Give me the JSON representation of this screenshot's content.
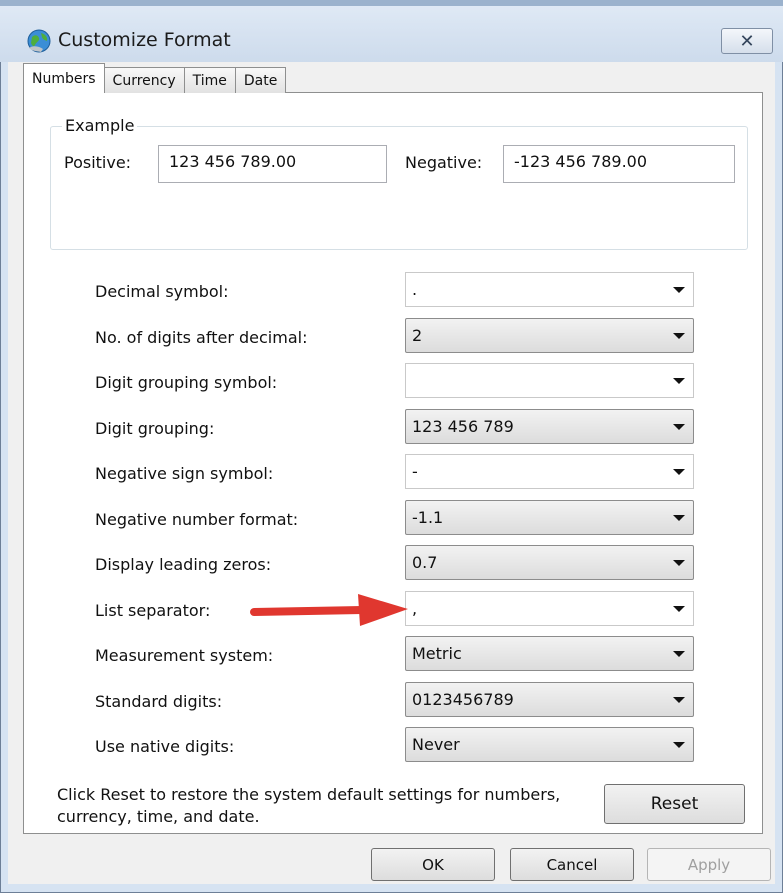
{
  "window": {
    "title": "Customize Format",
    "close_glyph": "✕"
  },
  "tabs": [
    {
      "label": "Numbers",
      "active": true
    },
    {
      "label": "Currency",
      "active": false
    },
    {
      "label": "Time",
      "active": false
    },
    {
      "label": "Date",
      "active": false
    }
  ],
  "example": {
    "legend": "Example",
    "positive_label": "Positive:",
    "positive_value": "123 456 789.00",
    "negative_label": "Negative:",
    "negative_value": "-123 456 789.00"
  },
  "settings": [
    {
      "label": "Decimal symbol:",
      "value": ".",
      "kind": "edit"
    },
    {
      "label": "No. of digits after decimal:",
      "value": "2",
      "kind": "dd"
    },
    {
      "label": "Digit grouping symbol:",
      "value": "",
      "kind": "edit"
    },
    {
      "label": "Digit grouping:",
      "value": "123 456 789",
      "kind": "dd"
    },
    {
      "label": "Negative sign symbol:",
      "value": "-",
      "kind": "edit"
    },
    {
      "label": "Negative number format:",
      "value": "-1.1",
      "kind": "dd"
    },
    {
      "label": "Display leading zeros:",
      "value": "0.7",
      "kind": "dd"
    },
    {
      "label": "List separator:",
      "value": ",",
      "kind": "edit"
    },
    {
      "label": "Measurement system:",
      "value": "Metric",
      "kind": "dd"
    },
    {
      "label": "Standard digits:",
      "value": "0123456789",
      "kind": "dd"
    },
    {
      "label": "Use native digits:",
      "value": "Never",
      "kind": "dd"
    }
  ],
  "reset_note": "Click Reset to restore the system default settings for numbers, currency, time, and date.",
  "buttons": {
    "reset": "Reset",
    "ok": "OK",
    "cancel": "Cancel",
    "apply": "Apply"
  },
  "colors": {
    "annotation_arrow": "#e0372f",
    "window_frame": "#cddbec"
  },
  "icons": {
    "title": "globe-icon",
    "annotation": "red-arrow-icon"
  }
}
